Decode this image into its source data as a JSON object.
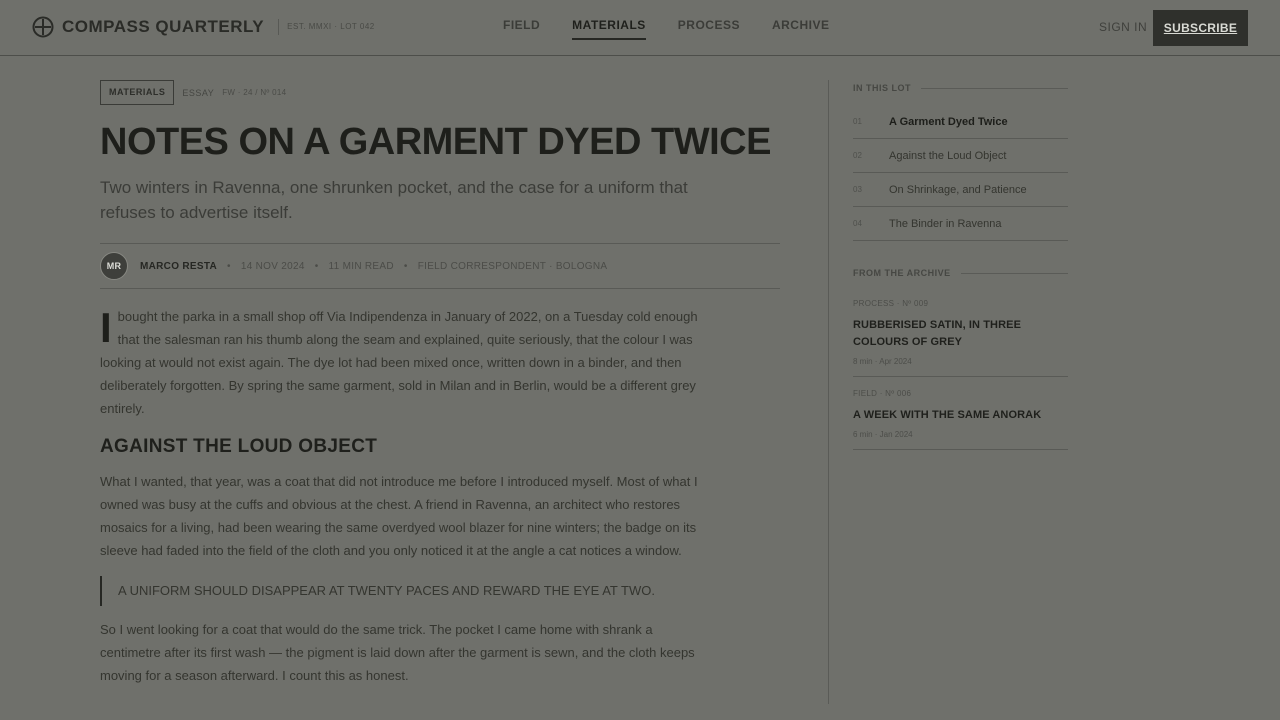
{
  "colors": {
    "background": "#6f706b",
    "ink": "#1e1f1b",
    "button": "#2f302c",
    "button_text": "#d9dad4"
  },
  "header": {
    "brand_icon": "compass-crosshair-icon",
    "brand_name": "COMPASS QUARTERLY",
    "brand_meta": "EST. MMXI · LOT 042",
    "nav": [
      {
        "label": "FIELD",
        "active": false
      },
      {
        "label": "MATERIALS",
        "active": true
      },
      {
        "label": "PROCESS",
        "active": false
      },
      {
        "label": "ARCHIVE",
        "active": false
      }
    ],
    "sign_in": "SIGN IN",
    "subscribe": "SUBSCRIBE"
  },
  "article": {
    "tag_primary": "MATERIALS",
    "tag_secondary": "ESSAY",
    "issue": "FW · 24 / Nº 014",
    "headline": "NOTES ON A GARMENT DYED TWICE",
    "standfirst": "Two winters in Ravenna, one shrunken pocket, and the case for a uniform that refuses to advertise itself.",
    "byline": {
      "initials": "MR",
      "author": "MARCO RESTA",
      "date": "14 NOV 2024",
      "read_time": "11 MIN READ",
      "role": "FIELD CORRESPONDENT · BOLOGNA",
      "separator": "•"
    },
    "dropcap": "I",
    "para1": "bought the parka in a small shop off Via Indipendenza in January of 2022, on a Tuesday cold enough that the salesman ran his thumb along the seam and explained, quite seriously, that the colour I was looking at would not exist again. The dye lot had been mixed once, written down in a binder, and then deliberately forgotten. By spring the same garment, sold in Milan and in Berlin, would be a different grey entirely.",
    "section_head": "AGAINST THE LOUD OBJECT",
    "para2": "What I wanted, that year, was a coat that did not introduce me before I introduced myself. Most of what I owned was busy at the cuffs and obvious at the chest. A friend in Ravenna, an architect who restores mosaics for a living, had been wearing the same overdyed wool blazer for nine winters; the badge on its sleeve had faded into the field of the cloth and you only noticed it at the angle a cat notices a window.",
    "pullquote": "A UNIFORM SHOULD DISAPPEAR AT TWENTY PACES AND REWARD THE EYE AT TWO.",
    "para3": "So I went looking for a coat that would do the same trick. The pocket I came home with shrank a centimetre after its first wash — the pigment is laid down after the garment is sewn, and the cloth keeps moving for a season afterward. I count this as honest."
  },
  "sidebar": {
    "in_this_lot_title": "IN THIS LOT",
    "toc": [
      {
        "num": "01",
        "title": "A Garment Dyed Twice",
        "current": true
      },
      {
        "num": "02",
        "title": "Against the Loud Object",
        "current": false
      },
      {
        "num": "03",
        "title": "On Shrinkage, and Patience",
        "current": false
      },
      {
        "num": "04",
        "title": "The Binder in Ravenna",
        "current": false
      }
    ],
    "archive_title": "FROM THE ARCHIVE",
    "archive": [
      {
        "kicker": "PROCESS · Nº 009",
        "title": "RUBBERISED SATIN, IN THREE COLOURS OF GREY",
        "meta": "8 min · Apr 2024"
      },
      {
        "kicker": "FIELD · Nº 006",
        "title": "A WEEK WITH THE SAME ANORAK",
        "meta": "6 min · Jan 2024"
      }
    ]
  }
}
